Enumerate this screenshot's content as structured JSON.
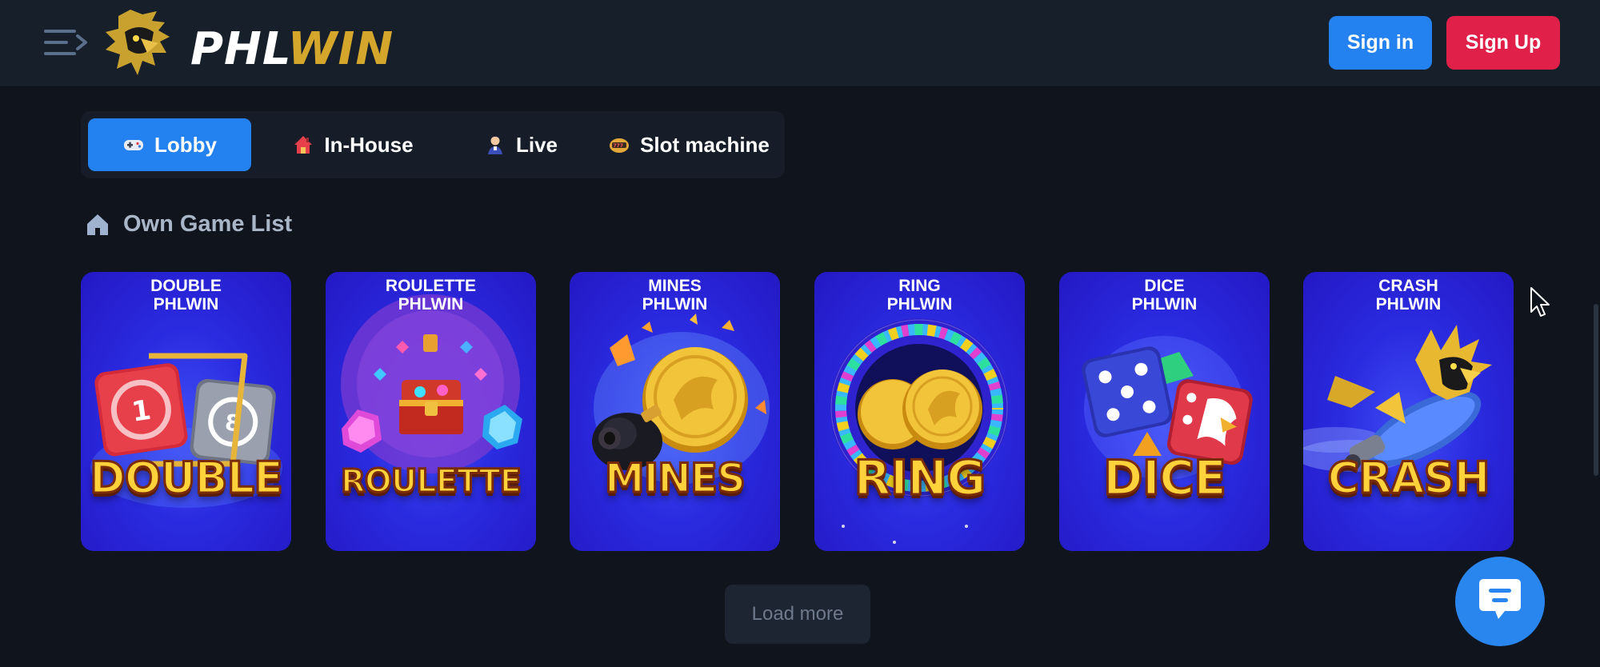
{
  "header": {
    "menu_icon": "hamburger-arrow-icon",
    "logo_icon": "golden-eagle-icon",
    "logo_text_a": "PHL",
    "logo_text_b": "WIN",
    "signin_label": "Sign in",
    "signup_label": "Sign Up"
  },
  "tabs": [
    {
      "label": "Lobby",
      "icon": "gamepad-icon",
      "active": true
    },
    {
      "label": "In-House",
      "icon": "house-icon",
      "active": false
    },
    {
      "label": "Live",
      "icon": "dealer-icon",
      "active": false
    },
    {
      "label": "Slot machine",
      "icon": "slot-icon",
      "active": false
    }
  ],
  "section": {
    "title": "Own Game List",
    "icon": "home-icon"
  },
  "games": [
    {
      "title": "DOUBLE\nPHLWIN",
      "word": "DOUBLE"
    },
    {
      "title": "ROULETTE\nPHLWIN",
      "word": "ROULETTE"
    },
    {
      "title": "MINES\nPHLWIN",
      "word": "MINES"
    },
    {
      "title": "RING\nPHLWIN",
      "word": "RING"
    },
    {
      "title": "DICE\nPHLWIN",
      "word": "DICE"
    },
    {
      "title": "CRASH\nPHLWIN",
      "word": "CRASH"
    }
  ],
  "load_more_label": "Load more",
  "chat_icon": "chat-bubble-icon",
  "colors": {
    "background": "#0f141d",
    "header": "#171f2b",
    "accent_blue": "#2482f0",
    "signup_red": "#e02048",
    "logo_gold": "#d4a72c"
  }
}
